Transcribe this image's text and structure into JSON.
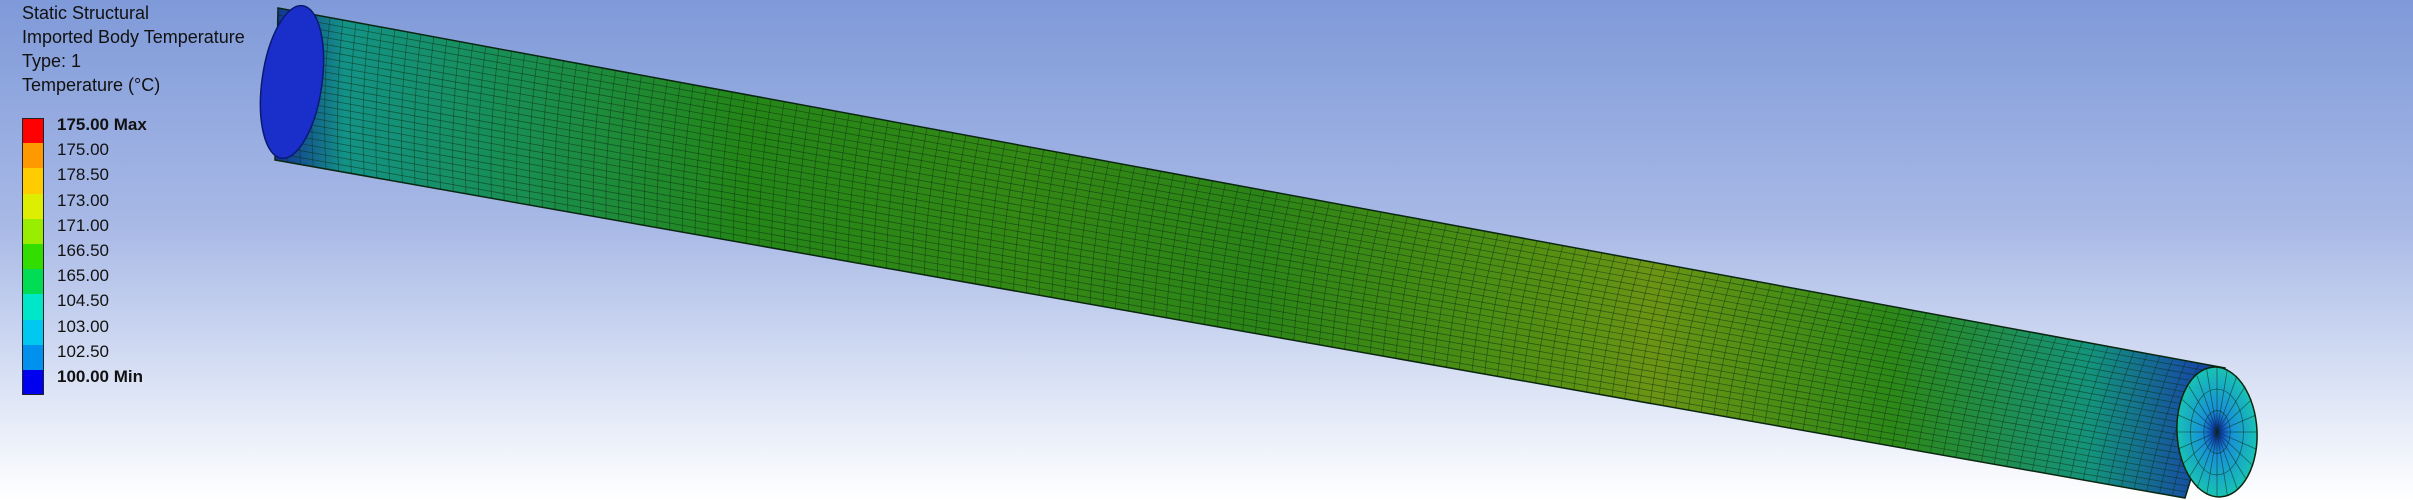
{
  "legend": {
    "analysis": "Static Structural",
    "result": "Imported Body Temperature",
    "type": "Type: 1",
    "quantity": "Temperature (°C)",
    "entries": [
      {
        "label": "175.00 Max",
        "color": "#ff0000",
        "strong": true
      },
      {
        "label": "175.00",
        "color": "#ff9900",
        "strong": false
      },
      {
        "label": "178.50",
        "color": "#ffcc00",
        "strong": false
      },
      {
        "label": "173.00",
        "color": "#ddee00",
        "strong": false
      },
      {
        "label": "171.00",
        "color": "#99ee00",
        "strong": false
      },
      {
        "label": "166.50",
        "color": "#33dd00",
        "strong": false
      },
      {
        "label": "165.00",
        "color": "#00dd55",
        "strong": false
      },
      {
        "label": "104.50",
        "color": "#00e6c8",
        "strong": false
      },
      {
        "label": "103.00",
        "color": "#00c8f0",
        "strong": false
      },
      {
        "label": "102.50",
        "color": "#0090ee",
        "strong": false
      },
      {
        "label": "100.00 Min",
        "color": "#0000ee",
        "strong": true
      }
    ]
  },
  "model": {
    "name": "cylinder-mesh",
    "colors": {
      "end_blue": "#1a2fc9",
      "cyan": "#19c2b4",
      "green": "#2fb31f",
      "yellow_green": "#8fc51a",
      "mesh_line": "#0b2b12"
    }
  }
}
